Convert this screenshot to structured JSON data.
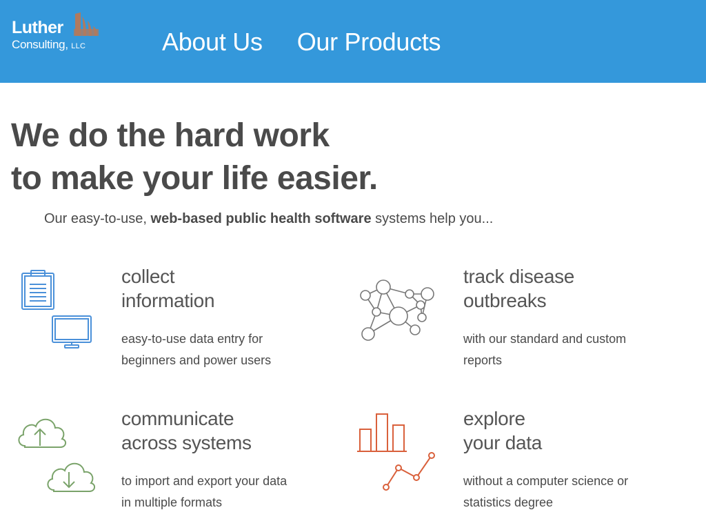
{
  "header": {
    "logo": {
      "line1": "Luther",
      "line2": "Consulting,",
      "line3": "LLC"
    },
    "nav": [
      {
        "label": "About Us"
      },
      {
        "label": "Our Products"
      }
    ]
  },
  "hero": {
    "line1": "We do the hard work",
    "line2": "to make your life easier.",
    "intro_before": "Our easy-to-use, ",
    "intro_bold": "web-based public health software",
    "intro_after": " systems help you..."
  },
  "features": [
    {
      "title1": "collect",
      "title2": "information",
      "desc1": "easy-to-use data entry for",
      "desc2": "beginners and power users",
      "icon": "clipboard-monitor-icon"
    },
    {
      "title1": "track disease",
      "title2": "outbreaks",
      "desc1": "with our standard and custom",
      "desc2": "reports",
      "icon": "network-icon"
    },
    {
      "title1": "communicate",
      "title2": "across systems",
      "desc1": "to import and export your data",
      "desc2": "in multiple formats",
      "icon": "cloud-upload-download-icon"
    },
    {
      "title1": "explore",
      "title2": "your data",
      "desc1": "without a computer science or",
      "desc2": "statistics degree",
      "icon": "bar-line-chart-icon"
    }
  ],
  "colors": {
    "header_bg": "#3498db",
    "blue_icon": "#4a90d9",
    "green_icon": "#7aa36a",
    "orange_icon": "#d9603b",
    "gray_icon": "#777777"
  }
}
